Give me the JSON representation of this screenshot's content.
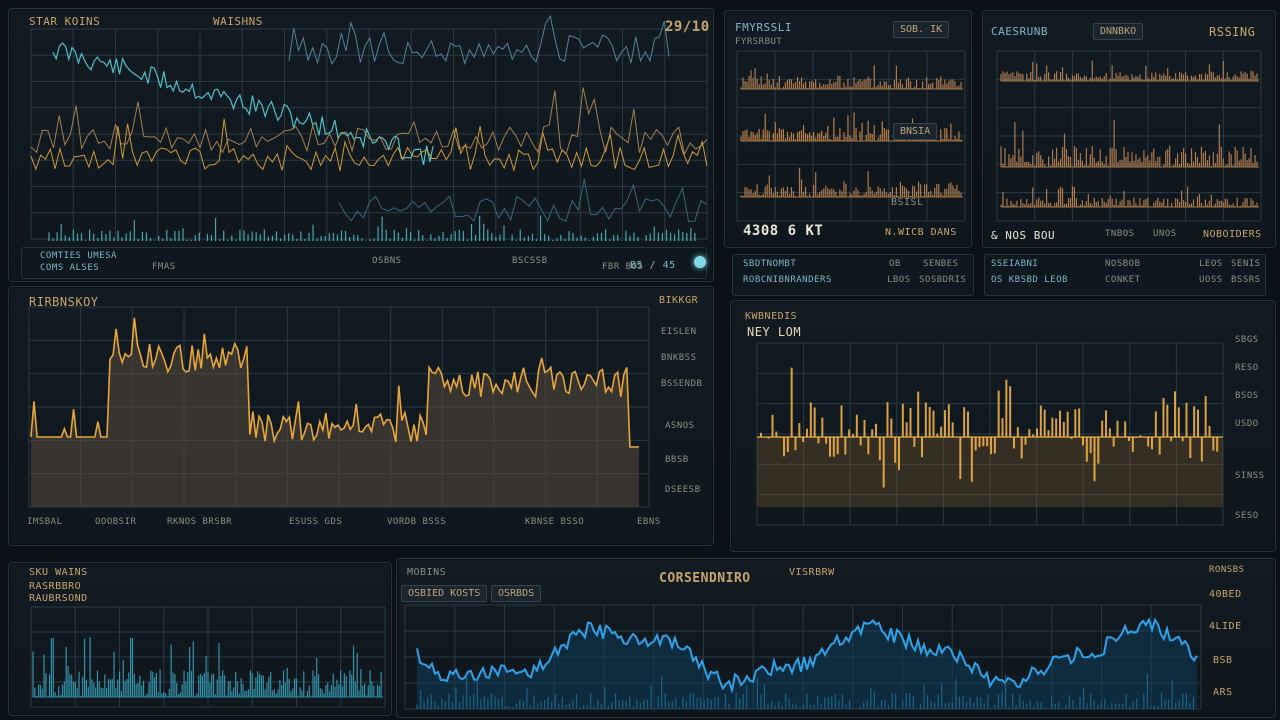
{
  "panels": {
    "p1": {
      "title": "STAR KOINS",
      "subtitle": "WAISHNS",
      "top_right": "29/10",
      "footer_labels": [
        "COMTIES UMESA",
        "COMS ALSES",
        "FMAS",
        "OSBNS",
        "BSCSSB",
        "FBR BOS"
      ],
      "footer_value": "B5 / 45"
    },
    "p2": {
      "title": "FMYRSSLI",
      "subtitle": "FYRSRBUT",
      "header_chip": "SOB. IK",
      "footer_left": "4308 6 KT",
      "footer_right": "N.WICB DANS",
      "mid_chip": "BNSIA",
      "bottom_chip": "BSISL"
    },
    "p3": {
      "title": "CAESRUNB",
      "subtitle": "DNNBKO",
      "top_right": "RSSING",
      "footer_left": "& NOS BOU",
      "footer_mid": "TNBOS",
      "footer_mid2": "UNOS",
      "footer_right": "NOBOIDERS"
    },
    "info_strips": {
      "left": {
        "col1": [
          "SBDTNOMBT",
          "ROBCNIBNRANDERS"
        ],
        "col2": [
          "OB",
          "LBOS"
        ],
        "col3": [
          "SENBES",
          "SOSBDRIS"
        ]
      },
      "right": {
        "col1": [
          "SSEIABNI",
          "OS KBSBD LEOB"
        ],
        "col2": [
          "NOSBOB",
          "CONKET"
        ],
        "col3": [
          "LEOS",
          "UOSS"
        ],
        "col4": [
          "SENIS",
          "BSSRS"
        ]
      }
    },
    "p4": {
      "title": "RIRBNSKOY",
      "right_labels": [
        "BIKKGR",
        "EISLEN",
        "BNKBSS",
        "BSSENDB",
        "ASNOS",
        "BBSB",
        "DSEESB"
      ],
      "footer_labels": [
        "IMSBAL",
        "OOOBSIR",
        "RKNOS BRSBR",
        "ESUSS GDS",
        "VORDB BSSS",
        "KBNSE BSSO",
        "EBNS"
      ]
    },
    "p5": {
      "title": "KWBNEDIS",
      "subtitle": "NEY LOM",
      "right_labels": [
        "SBGS",
        "RESO",
        "BSOS",
        "USDO",
        "SINSS",
        "SESO"
      ]
    },
    "p6": {
      "title": "SKU WAINS",
      "subtitle": "RASRBBRO",
      "subtitle2": "RAUBRSOND"
    },
    "p7": {
      "title": "MOBINS",
      "chip1": "OSBIED KOSTS",
      "chip2": "OSRBDS",
      "headline": "CORSENDNIRO",
      "tag": "VISRBRW",
      "right_labels": [
        "RONSBS",
        "40BED",
        "4LIDE",
        "BSB",
        "ARS"
      ]
    }
  },
  "colors": {
    "amber": "#e6a63a",
    "teal": "#4fc1c7",
    "blue": "#2ea2e8",
    "grid": "#2a3a44"
  },
  "status_dot": "status-indicator"
}
